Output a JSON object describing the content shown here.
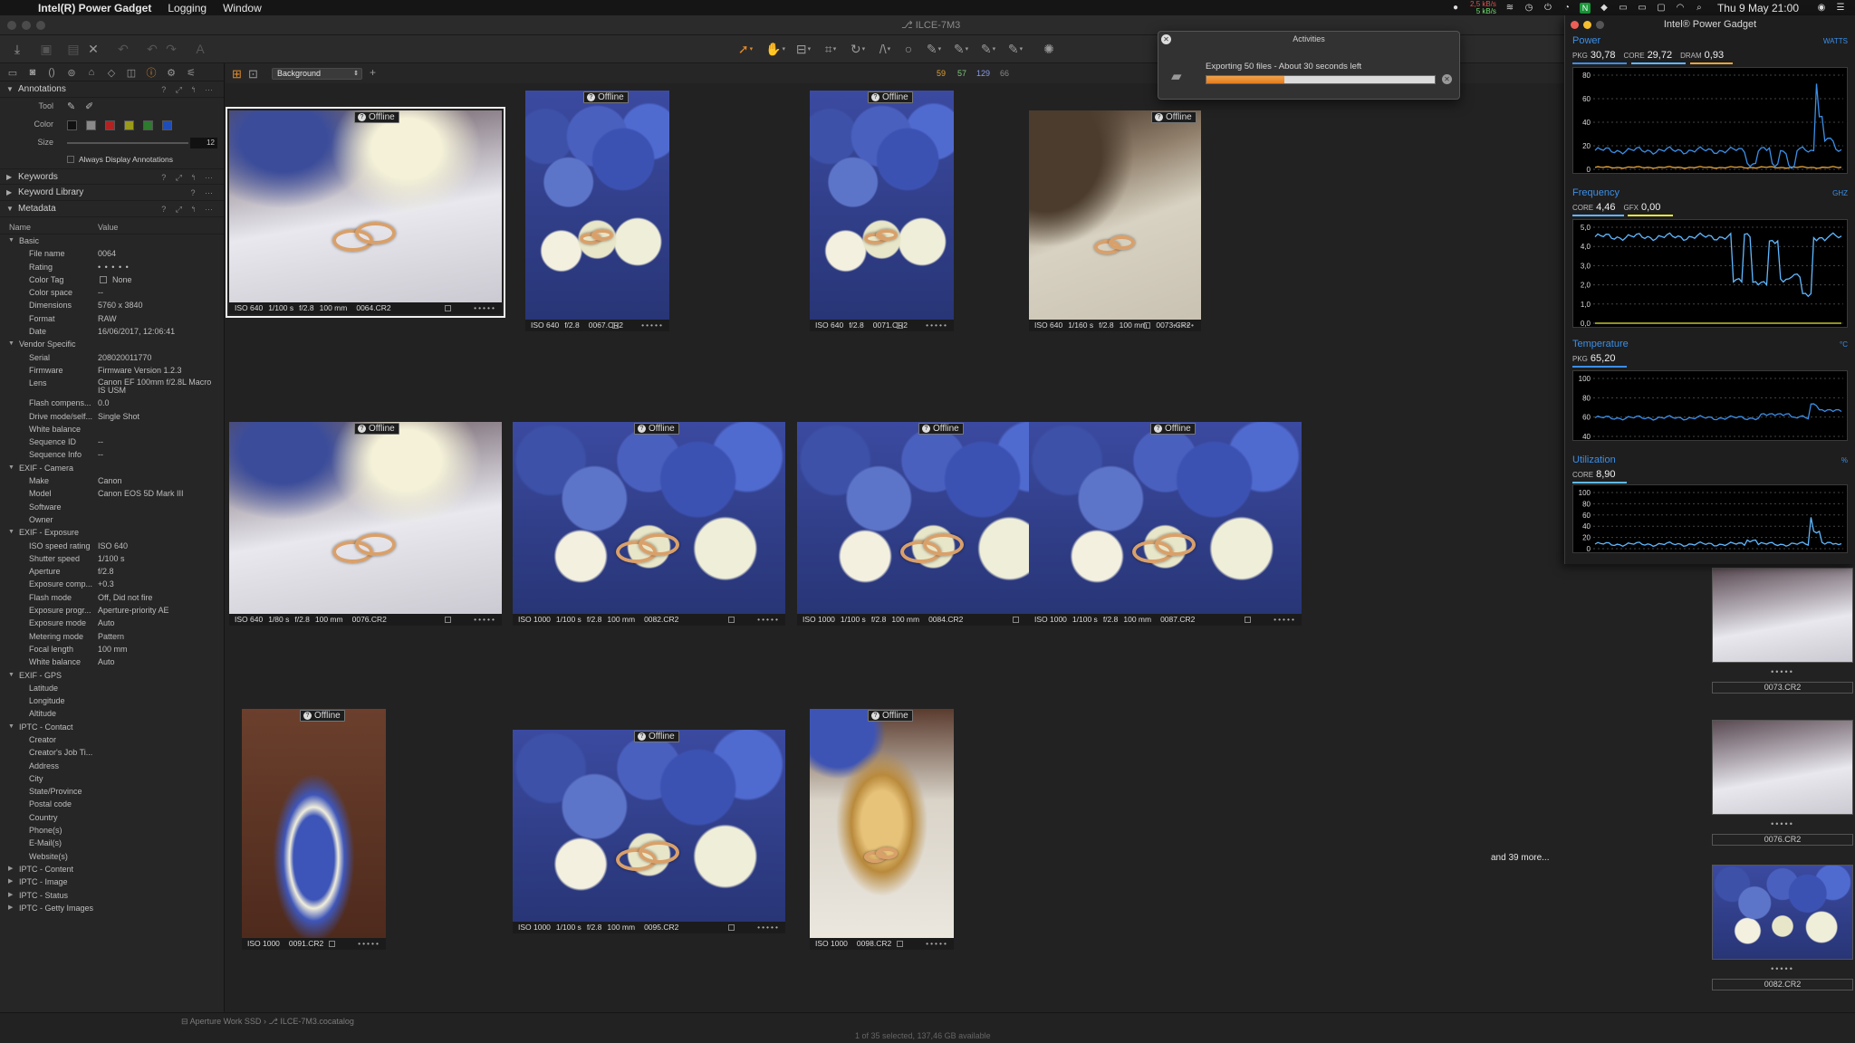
{
  "menubar": {
    "app": "Intel(R) Power Gadget",
    "menus": [
      "Logging",
      "Window"
    ],
    "net_up": "2,5 kB/s",
    "net_down": "5 kB/s",
    "clock": "Thu 9 May  21:00"
  },
  "window": {
    "title": "ILCE-7M3"
  },
  "grid_header": {
    "view_option": "Background",
    "counts": [
      "59",
      "57",
      "129",
      "66"
    ]
  },
  "annotations": {
    "title": "Annotations",
    "tool_label": "Tool",
    "color_label": "Color",
    "size_label": "Size",
    "size_value": "12",
    "always_display": "Always Display Annotations",
    "swatch_colors": [
      "#111111",
      "#8a8a8a",
      "#b22222",
      "#9a9a1a",
      "#2e7a2e",
      "#1f4db8"
    ]
  },
  "sections": {
    "keywords": "Keywords",
    "keyword_library": "Keyword Library",
    "metadata": "Metadata"
  },
  "metadata": {
    "col_name": "Name",
    "col_value": "Value",
    "rows": [
      {
        "g": "Basic"
      },
      {
        "k": "File name",
        "v": "0064"
      },
      {
        "k": "Rating",
        "v": "• • • • •"
      },
      {
        "k": "Color Tag",
        "v": "None"
      },
      {
        "k": "Color space",
        "v": "--"
      },
      {
        "k": "Dimensions",
        "v": "5760 x 3840"
      },
      {
        "k": "Format",
        "v": "RAW"
      },
      {
        "k": "Date",
        "v": "16/06/2017, 12:06:41"
      },
      {
        "g": "Vendor Specific"
      },
      {
        "k": "Serial",
        "v": "208020011770"
      },
      {
        "k": "Firmware",
        "v": "Firmware Version 1.2.3"
      },
      {
        "k": "Lens",
        "v": "Canon EF 100mm f/2.8L Macro IS USM"
      },
      {
        "k": "Flash compens...",
        "v": "0.0"
      },
      {
        "k": "Drive mode/self...",
        "v": "Single Shot"
      },
      {
        "k": "White balance",
        "v": ""
      },
      {
        "k": "Sequence ID",
        "v": "--"
      },
      {
        "k": "Sequence Info",
        "v": "--"
      },
      {
        "g": "EXIF - Camera"
      },
      {
        "k": "Make",
        "v": "Canon"
      },
      {
        "k": "Model",
        "v": "Canon EOS 5D Mark III"
      },
      {
        "k": "Software",
        "v": ""
      },
      {
        "k": "Owner",
        "v": ""
      },
      {
        "g": "EXIF - Exposure"
      },
      {
        "k": "ISO speed rating",
        "v": "ISO 640"
      },
      {
        "k": "Shutter speed",
        "v": "1/100 s"
      },
      {
        "k": "Aperture",
        "v": "f/2.8"
      },
      {
        "k": "Exposure comp...",
        "v": "+0.3"
      },
      {
        "k": "Flash mode",
        "v": "Off, Did not fire"
      },
      {
        "k": "Exposure progr...",
        "v": "Aperture-priority AE"
      },
      {
        "k": "Exposure mode",
        "v": "Auto"
      },
      {
        "k": "Metering mode",
        "v": "Pattern"
      },
      {
        "k": "Focal length",
        "v": "100 mm"
      },
      {
        "k": "White balance",
        "v": "Auto"
      },
      {
        "g": "EXIF - GPS"
      },
      {
        "k": "Latitude",
        "v": ""
      },
      {
        "k": "Longitude",
        "v": ""
      },
      {
        "k": "Altitude",
        "v": ""
      },
      {
        "g": "IPTC - Contact"
      },
      {
        "k": "Creator",
        "v": ""
      },
      {
        "k": "Creator's Job Ti...",
        "v": ""
      },
      {
        "k": "Address",
        "v": ""
      },
      {
        "k": "City",
        "v": ""
      },
      {
        "k": "State/Province",
        "v": ""
      },
      {
        "k": "Postal code",
        "v": ""
      },
      {
        "k": "Country",
        "v": ""
      },
      {
        "k": "Phone(s)",
        "v": ""
      },
      {
        "k": "E-Mail(s)",
        "v": ""
      },
      {
        "k": "Website(s)",
        "v": ""
      },
      {
        "gc": "IPTC - Content"
      },
      {
        "gc": "IPTC - Image"
      },
      {
        "gc": "IPTC - Status"
      },
      {
        "gc": "IPTC - Getty Images"
      }
    ]
  },
  "offline_label": "Offline",
  "thumbnails": [
    {
      "iso": "ISO 640",
      "shutter": "1/100 s",
      "ap": "f/2.8",
      "fl": "100 mm",
      "file": "0064.CR2",
      "selected": true
    },
    {
      "iso": "ISO 640",
      "shutter": "",
      "ap": "f/2.8",
      "fl": "",
      "file": "0067.CR2"
    },
    {
      "iso": "ISO 640",
      "shutter": "",
      "ap": "f/2.8",
      "fl": "",
      "file": "0071.CR2"
    },
    {
      "iso": "ISO 640",
      "shutter": "1/160 s",
      "ap": "f/2.8",
      "fl": "100 mm",
      "file": "0073.CR2"
    },
    {
      "iso": "ISO 640",
      "shutter": "1/80 s",
      "ap": "f/2.8",
      "fl": "100 mm",
      "file": "0076.CR2"
    },
    {
      "iso": "ISO 1000",
      "shutter": "1/100 s",
      "ap": "f/2.8",
      "fl": "100 mm",
      "file": "0082.CR2"
    },
    {
      "iso": "ISO 1000",
      "shutter": "1/100 s",
      "ap": "f/2.8",
      "fl": "100 mm",
      "file": "0084.CR2"
    },
    {
      "iso": "ISO 1000",
      "shutter": "1/100 s",
      "ap": "f/2.8",
      "fl": "100 mm",
      "file": "0087.CR2"
    },
    {
      "iso": "ISO 1000",
      "shutter": "",
      "ap": "",
      "fl": "",
      "file": "0091.CR2"
    },
    {
      "iso": "ISO 1000",
      "shutter": "1/100 s",
      "ap": "f/2.8",
      "fl": "100 mm",
      "file": "0095.CR2"
    },
    {
      "iso": "ISO 1000",
      "shutter": "",
      "ap": "",
      "fl": "",
      "file": "0098.CR2"
    }
  ],
  "more_label": "and 39 more...",
  "filmstrip": [
    "0073.CR2",
    "0076.CR2",
    "0082.CR2"
  ],
  "activities": {
    "title": "Activities",
    "text": "Exporting 50 files - About 30 seconds left",
    "progress": 0.34
  },
  "statusbar": {
    "path": [
      "Aperture Work SSD",
      "ILCE-7M3.cocatalog"
    ],
    "selection": "1 of 35 selected, 137,46 GB available"
  },
  "gadget": {
    "title": "Intel® Power Gadget",
    "power": {
      "label": "Power",
      "unit": "WATTS",
      "pkg_label": "PKG",
      "pkg": "30,78",
      "core_label": "CORE",
      "core": "29,72",
      "dram_label": "DRAM",
      "dram": "0,93",
      "ticks": [
        "80",
        "60",
        "40",
        "20",
        "0"
      ]
    },
    "frequency": {
      "label": "Frequency",
      "unit": "GHZ",
      "core_label": "CORE",
      "core": "4,46",
      "gfx_label": "GFX",
      "gfx": "0,00",
      "ticks": [
        "5,0",
        "4,0",
        "3,0",
        "2,0",
        "1,0",
        "0,0"
      ]
    },
    "temperature": {
      "label": "Temperature",
      "unit": "°C",
      "pkg_label": "PKG",
      "pkg": "65,20",
      "ticks": [
        "100",
        "80",
        "60",
        "40"
      ]
    },
    "utilization": {
      "label": "Utilization",
      "unit": "%",
      "core_label": "CORE",
      "core": "8,90",
      "ticks": [
        "100",
        "80",
        "60",
        "40",
        "20",
        "0"
      ]
    },
    "colors": {
      "accent": "#3b8fe8",
      "pkg": "#3b8fe8",
      "core": "#5fb8ff",
      "dram": "#e8a53b",
      "gfx": "#e8e83b"
    }
  }
}
